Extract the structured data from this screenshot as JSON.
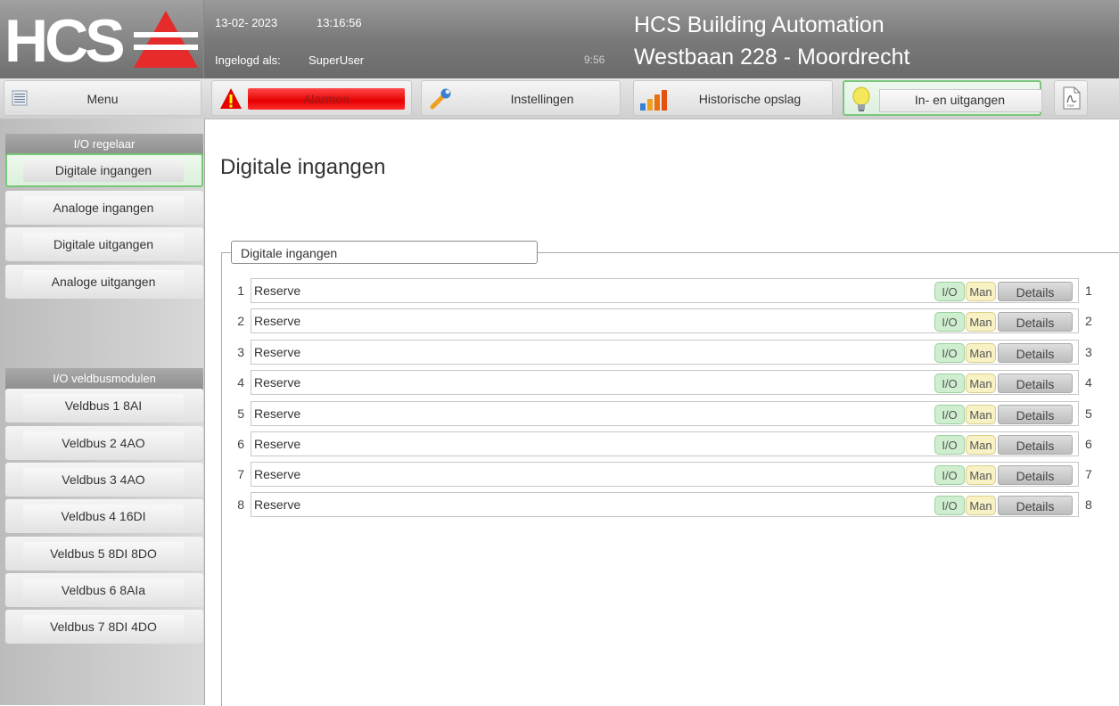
{
  "header": {
    "logo_text": "HCS",
    "date": "13-02- 2023",
    "time": "13:16:56",
    "user_label": "Ingelogd als:",
    "user_name": "SuperUser",
    "session_timer": "9:56",
    "title_line1": "HCS Building Automation",
    "title_line2": "Westbaan 228 - Moordrecht",
    "logo_triangle_color": "#e52b2b"
  },
  "menubar": {
    "menu_label": "Menu",
    "alarms_label": "Alarmen",
    "settings_label": "Instellingen",
    "history_label": "Historische opslag",
    "io_label": "In- en uitgangen",
    "icons": {
      "menu": "list-icon",
      "alarms": "warning-icon",
      "settings": "wrench-icon",
      "history": "bar-chart-icon",
      "io": "lightbulb-icon",
      "pdf": "pdf-icon"
    }
  },
  "sidebar": {
    "section1_title": "I/O regelaar",
    "section1_items": [
      "Digitale ingangen",
      "Analoge ingangen",
      "Digitale uitgangen",
      "Analoge uitgangen"
    ],
    "section2_title": "I/O veldbusmodulen",
    "section2_items": [
      "Veldbus 1 8AI",
      "Veldbus 2 4AO",
      "Veldbus 3 4AO",
      "Veldbus 4 16DI",
      "Veldbus 5 8DI 8DO",
      "Veldbus 6 8AIa",
      "Veldbus 7 8DI 4DO"
    ],
    "active_item": "Digitale ingangen"
  },
  "main": {
    "page_title": "Digitale ingangen",
    "group_title": "Digitale ingangen",
    "io_badge": "I/O",
    "man_badge": "Man",
    "details_label": "Details",
    "rows": [
      {
        "num": "1",
        "name": "Reserve"
      },
      {
        "num": "2",
        "name": "Reserve"
      },
      {
        "num": "3",
        "name": "Reserve"
      },
      {
        "num": "4",
        "name": "Reserve"
      },
      {
        "num": "5",
        "name": "Reserve"
      },
      {
        "num": "6",
        "name": "Reserve"
      },
      {
        "num": "7",
        "name": "Reserve"
      },
      {
        "num": "8",
        "name": "Reserve"
      }
    ]
  }
}
